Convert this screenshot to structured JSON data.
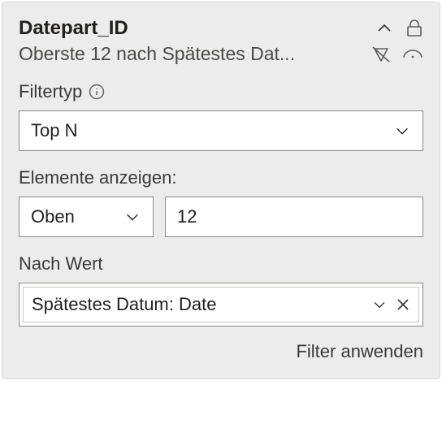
{
  "header": {
    "title": "Datepart_ID",
    "subtitle": "Oberste 12 nach Spätestes Dat..."
  },
  "filterType": {
    "label": "Filtertyp",
    "value": "Top N"
  },
  "showItems": {
    "label": "Elemente anzeigen:",
    "direction": "Oben",
    "count": "12"
  },
  "byValue": {
    "label": "Nach Wert",
    "chip": "Spätestes Datum: Date"
  },
  "apply": "Filter anwenden"
}
